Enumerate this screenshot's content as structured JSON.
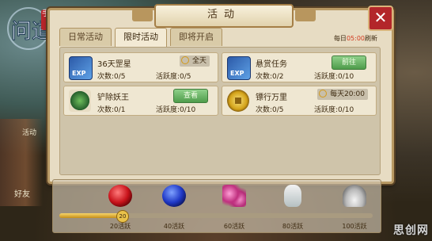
{
  "game": {
    "logo_text": "问道",
    "logo_badge": "手游"
  },
  "side": {
    "label_top": "活动",
    "label_bottom": "好友"
  },
  "window": {
    "title": "活动",
    "close_label": "✕"
  },
  "tabs": [
    {
      "label": "日常活动",
      "active": false
    },
    {
      "label": "限时活动",
      "active": true
    },
    {
      "label": "即将开启",
      "active": false
    }
  ],
  "refresh": {
    "prefix": "每日",
    "time": "05:00",
    "suffix": "刷新"
  },
  "activities": [
    {
      "name": "36天罡星",
      "count": "次数:0/5",
      "activity": "活跃度:0/5",
      "time_tag": "全天",
      "icon": "exp-book-icon"
    },
    {
      "name": "悬赏任务",
      "count": "次数:0/2",
      "activity": "活跃度:0/10",
      "button": "前往",
      "icon": "exp-book-icon"
    },
    {
      "name": "铲除妖王",
      "count": "次数:0/1",
      "activity": "活跃度:0/10",
      "button": "查看",
      "icon": "snake-icon"
    },
    {
      "name": "镖行万里",
      "count": "次数:0/5",
      "activity": "活跃度:0/10",
      "time_tag": "每天20:00",
      "icon": "coin-icon"
    }
  ],
  "rewards": {
    "progress_value": 20,
    "progress_max": 100,
    "knob_label": "20",
    "items": [
      {
        "label": "20活跃",
        "icon": "red-gem-icon"
      },
      {
        "label": "40活跃",
        "icon": "blue-gem-icon"
      },
      {
        "label": "60活跃",
        "icon": "pink-gem-icon"
      },
      {
        "label": "80活跃",
        "icon": "vase-icon"
      },
      {
        "label": "100活跃",
        "icon": "silver-ingot-icon"
      }
    ]
  },
  "watermark": "思创网"
}
